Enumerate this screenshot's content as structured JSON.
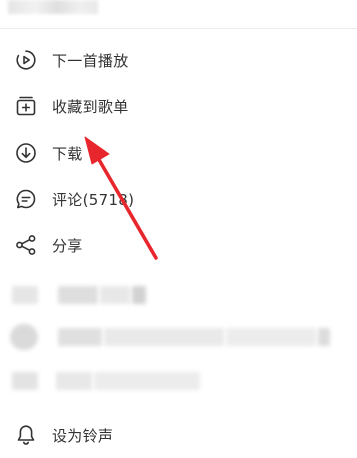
{
  "menu": {
    "items": [
      {
        "icon": "play-circle-icon",
        "label": "下一首播放"
      },
      {
        "icon": "add-square-icon",
        "label": "收藏到歌单"
      },
      {
        "icon": "download-icon",
        "label": "下载"
      },
      {
        "icon": "comment-icon",
        "label": "评论(5718)"
      },
      {
        "icon": "share-icon",
        "label": "分享"
      }
    ],
    "ringtone": {
      "icon": "bell-icon",
      "label": "设为铃声"
    }
  },
  "annotation": {
    "type": "arrow",
    "color": "#e8262d",
    "points_to": "下载"
  }
}
